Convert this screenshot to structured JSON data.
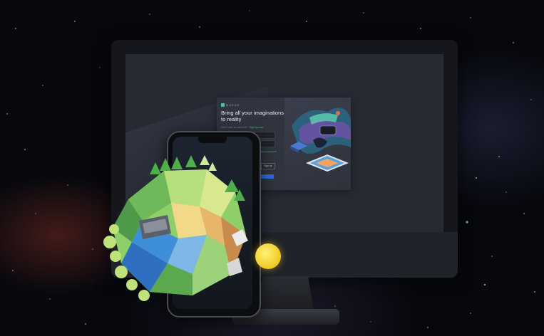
{
  "login_card": {
    "brand": "MAKAR",
    "headline": "Bring all your imaginations to reality",
    "signin_prompt": "Don't have an account?",
    "signin_link": "Sign up now",
    "forgot_link": "Forgot password?",
    "secondary_button": "Sign up",
    "submit_button": ""
  },
  "icons": {
    "brand_mark": "square-logo-icon"
  },
  "colors": {
    "accent_green": "#3fc59a",
    "submit_blue": "#2d6ae0",
    "ball_yellow": "#f0c81e"
  }
}
